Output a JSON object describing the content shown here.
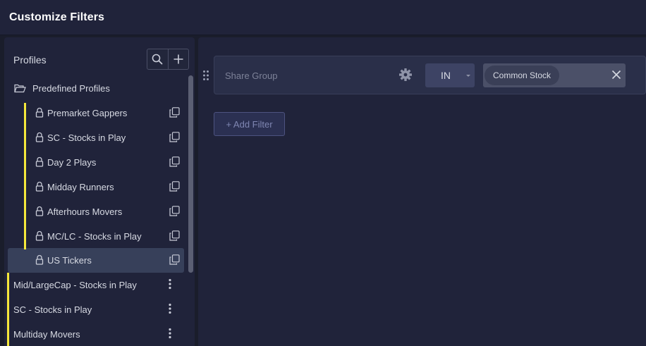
{
  "window": {
    "title": "Customize Filters"
  },
  "sidebar": {
    "header": "Profiles",
    "folder": {
      "label": "Predefined Profiles",
      "icon": "folder-open-icon"
    },
    "predefined": [
      {
        "label": "Premarket Gappers"
      },
      {
        "label": "SC - Stocks in Play"
      },
      {
        "label": "Day 2 Plays"
      },
      {
        "label": "Midday Runners"
      },
      {
        "label": "Afterhours Movers"
      },
      {
        "label": "MC/LC - Stocks in Play"
      },
      {
        "label": "US Tickers",
        "selected": true
      }
    ],
    "custom": [
      {
        "label": "Mid/LargeCap - Stocks in Play"
      },
      {
        "label": "SC - Stocks in Play"
      },
      {
        "label": "Multiday Movers"
      }
    ]
  },
  "filter": {
    "name": "Share Group",
    "operator": "IN",
    "values": [
      "Common Stock"
    ]
  },
  "add_filter_label": "+ Add Filter",
  "colors": {
    "accent_yellow": "#f5e83a",
    "selected_row": "#37405a",
    "panel_bg": "#20233a"
  }
}
